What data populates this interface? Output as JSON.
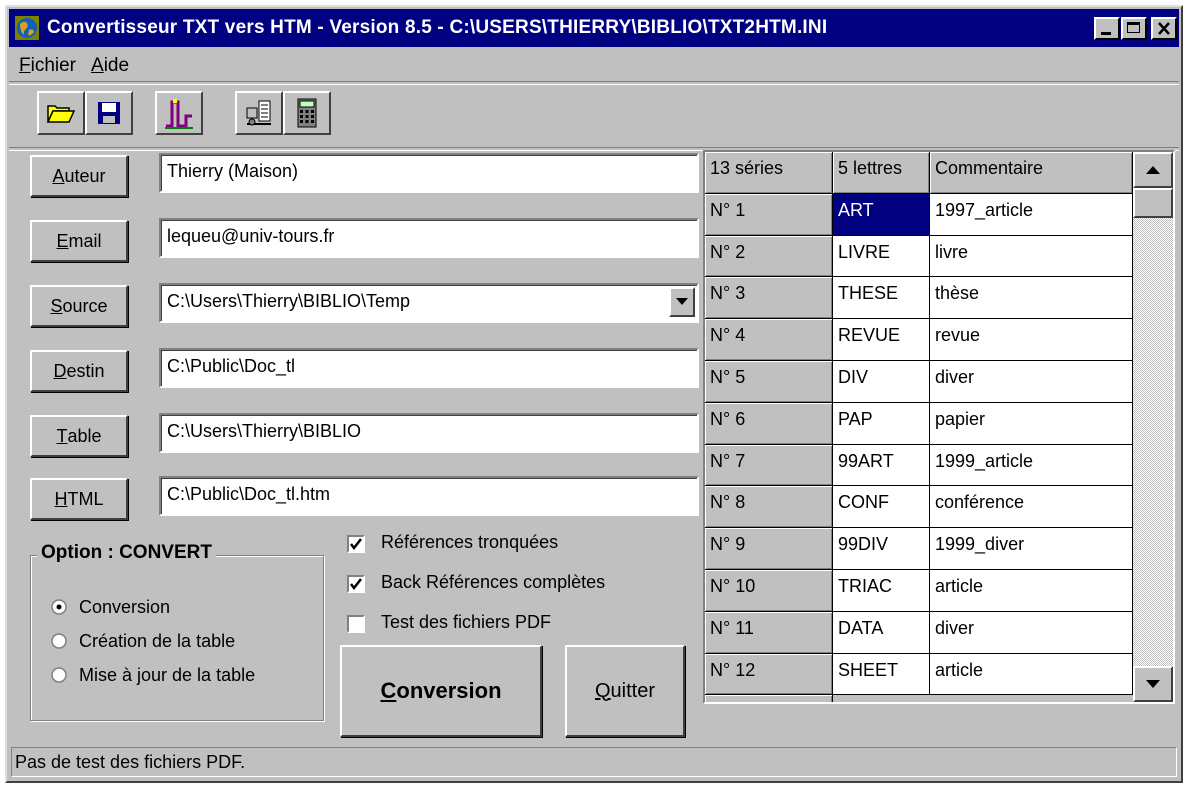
{
  "window": {
    "title": "Convertisseur TXT vers HTM - Version 8.5 - C:\\USERS\\THIERRY\\BIBLIO\\TXT2HTM.INI",
    "minimize": "minimize-icon",
    "maximize": "maximize-icon",
    "close": "close-icon"
  },
  "menu": {
    "file_pre": "",
    "file_acc": "F",
    "file_rest": "ichier",
    "help_acc": "A",
    "help_rest": "ide"
  },
  "toolbar": {
    "icons": [
      "open-folder-icon",
      "save-disk-icon",
      "ini-settings-icon",
      "network-icon",
      "calculator-icon"
    ]
  },
  "fields": {
    "auteur": {
      "acc": "A",
      "rest": "uteur",
      "value": "Thierry (Maison)"
    },
    "email": {
      "acc": "E",
      "rest": "mail",
      "value": "lequeu@univ-tours.fr"
    },
    "source": {
      "acc": "S",
      "rest": "ource",
      "value": "C:\\Users\\Thierry\\BIBLIO\\Temp"
    },
    "destin": {
      "acc": "D",
      "rest": "estin",
      "value": "C:\\Public\\Doc_tl"
    },
    "table": {
      "acc": "T",
      "rest": "able",
      "value": "C:\\Users\\Thierry\\BIBLIO"
    },
    "html": {
      "acc": "H",
      "rest": "TML",
      "value": "C:\\Public\\Doc_tl.htm"
    }
  },
  "option": {
    "title": "Option : CONVERT",
    "radios": [
      {
        "label": "Conversion",
        "checked": true
      },
      {
        "label": "Création de la table",
        "checked": false
      },
      {
        "label": "Mise à jour de la table",
        "checked": false
      }
    ]
  },
  "checks": [
    {
      "label": "Références tronquées",
      "checked": true
    },
    {
      "label": "Back Références complètes",
      "checked": true
    },
    {
      "label": "Test des fichiers PDF",
      "checked": false
    }
  ],
  "buttons": {
    "conversion_acc": "C",
    "conversion_rest": "onversion",
    "quitter_acc": "Q",
    "quitter_rest": "uitter"
  },
  "table": {
    "headers": [
      "13 séries",
      "5 lettres",
      "Commentaire"
    ],
    "rows": [
      {
        "n": "N° 1",
        "code": "ART",
        "comment": "1997_article",
        "selected": true
      },
      {
        "n": "N° 2",
        "code": "LIVRE",
        "comment": "livre"
      },
      {
        "n": "N° 3",
        "code": "THESE",
        "comment": "thèse"
      },
      {
        "n": "N° 4",
        "code": "REVUE",
        "comment": "revue"
      },
      {
        "n": "N° 5",
        "code": "DIV",
        "comment": "diver"
      },
      {
        "n": "N° 6",
        "code": "PAP",
        "comment": "papier"
      },
      {
        "n": "N° 7",
        "code": "99ART",
        "comment": "1999_article"
      },
      {
        "n": "N° 8",
        "code": "CONF",
        "comment": "conférence"
      },
      {
        "n": "N° 9",
        "code": "99DIV",
        "comment": "1999_diver"
      },
      {
        "n": "N° 10",
        "code": "TRIAC",
        "comment": "article"
      },
      {
        "n": "N° 11",
        "code": "DATA",
        "comment": "diver"
      },
      {
        "n": "N° 12",
        "code": "SHEET",
        "comment": "article"
      }
    ]
  },
  "status": "Pas de test des fichiers PDF."
}
